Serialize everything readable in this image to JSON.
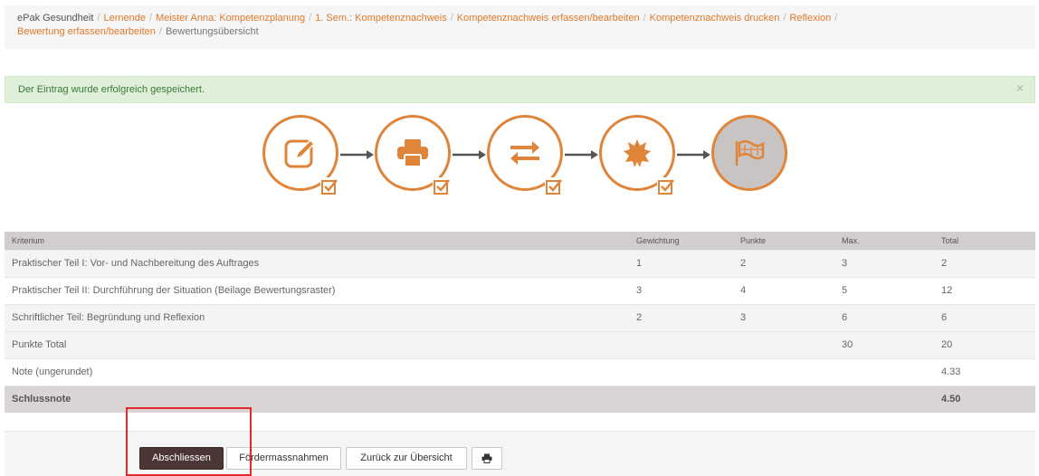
{
  "breadcrumb": {
    "items": [
      {
        "label": "ePak Gesundheit",
        "type": "root"
      },
      {
        "label": "Lernende",
        "type": "link"
      },
      {
        "label": "Meister Anna: Kompetenzplanung",
        "type": "link"
      },
      {
        "label": "1. Sem.: Kompetenznachweis",
        "type": "link"
      },
      {
        "label": "Kompetenznachweis erfassen/bearbeiten",
        "type": "link"
      },
      {
        "label": "Kompetenznachweis drucken",
        "type": "link"
      },
      {
        "label": "Reflexion",
        "type": "link"
      },
      {
        "label": "Bewertung erfassen/bearbeiten",
        "type": "link"
      },
      {
        "label": "Bewertungsübersicht",
        "type": "current"
      }
    ],
    "separator": "/"
  },
  "alert": {
    "message": "Der Eintrag wurde erfolgreich gespeichert.",
    "close": "×"
  },
  "workflow": {
    "steps": [
      {
        "icon": "edit-icon",
        "completed": true
      },
      {
        "icon": "print-icon",
        "completed": true
      },
      {
        "icon": "exchange-icon",
        "completed": true
      },
      {
        "icon": "badge-icon",
        "completed": true
      },
      {
        "icon": "flag-icon",
        "completed": false,
        "active": true
      }
    ],
    "colors": {
      "accent": "#e0843a",
      "active_bg": "#c9c4c4"
    }
  },
  "table": {
    "headers": [
      "Kriterium",
      "Gewichtung",
      "Punkte",
      "Max.",
      "Total"
    ],
    "rows": [
      [
        "Praktischer Teil I: Vor- und Nachbereitung des Auftrages",
        "1",
        "2",
        "3",
        "2"
      ],
      [
        "Praktischer Teil II: Durchführung der Situation (Beilage Bewertungsraster)",
        "3",
        "4",
        "5",
        "12"
      ],
      [
        "Schriftlicher Teil: Begründung und Reflexion",
        "2",
        "3",
        "6",
        "6"
      ],
      [
        "Punkte Total",
        "",
        "",
        "30",
        "20"
      ],
      [
        "Note (ungerundet)",
        "",
        "",
        "",
        "4.33"
      ]
    ],
    "final_row": [
      "Schlussnote",
      "",
      "",
      "",
      "4.50"
    ]
  },
  "footer": {
    "buttons": {
      "abschliessen": "Abschliessen",
      "foerdermassnahmen": "Fördermassnahmen",
      "zurueck": "Zurück zur Übersicht"
    },
    "print_icon": "print-icon"
  }
}
